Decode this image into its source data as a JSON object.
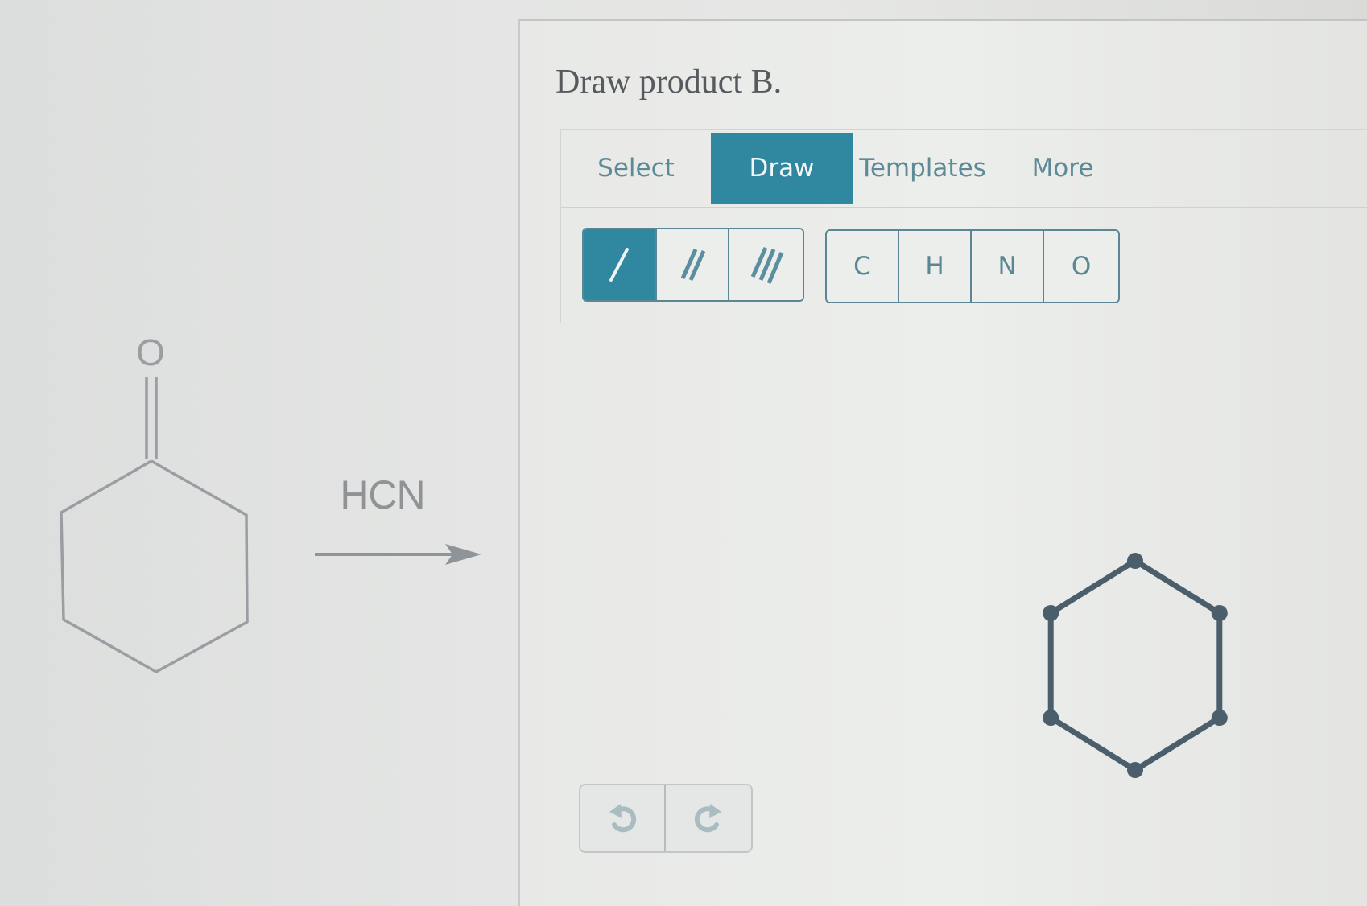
{
  "reaction": {
    "reactant_name": "cyclohexanone",
    "reactant_heteroatom_label": "O",
    "reagent": "HCN",
    "arrow": "reaction-arrow"
  },
  "panel": {
    "title": "Draw product B."
  },
  "toolbar": {
    "tabs": [
      {
        "label": "Select",
        "active": false
      },
      {
        "label": "Draw",
        "active": true
      },
      {
        "label": "Templates",
        "active": false
      },
      {
        "label": "More",
        "active": false
      }
    ],
    "bond_tools": [
      {
        "name": "single-bond",
        "active": true
      },
      {
        "name": "double-bond",
        "active": false
      },
      {
        "name": "triple-bond",
        "active": false
      }
    ],
    "atom_tools": [
      "C",
      "H",
      "N",
      "O"
    ]
  },
  "history": {
    "undo_icon": "undo-icon",
    "redo_icon": "redo-icon"
  },
  "canvas": {
    "drawn_structure": "six-membered ring",
    "atom_count": 6,
    "bond_count": 6
  },
  "colors": {
    "accent": "#2f87a0",
    "tool_text": "#5b8693",
    "drawn_bond": "#4a5e6c",
    "reactant_line": "#9a9ea2",
    "title_text": "#555a5e"
  }
}
